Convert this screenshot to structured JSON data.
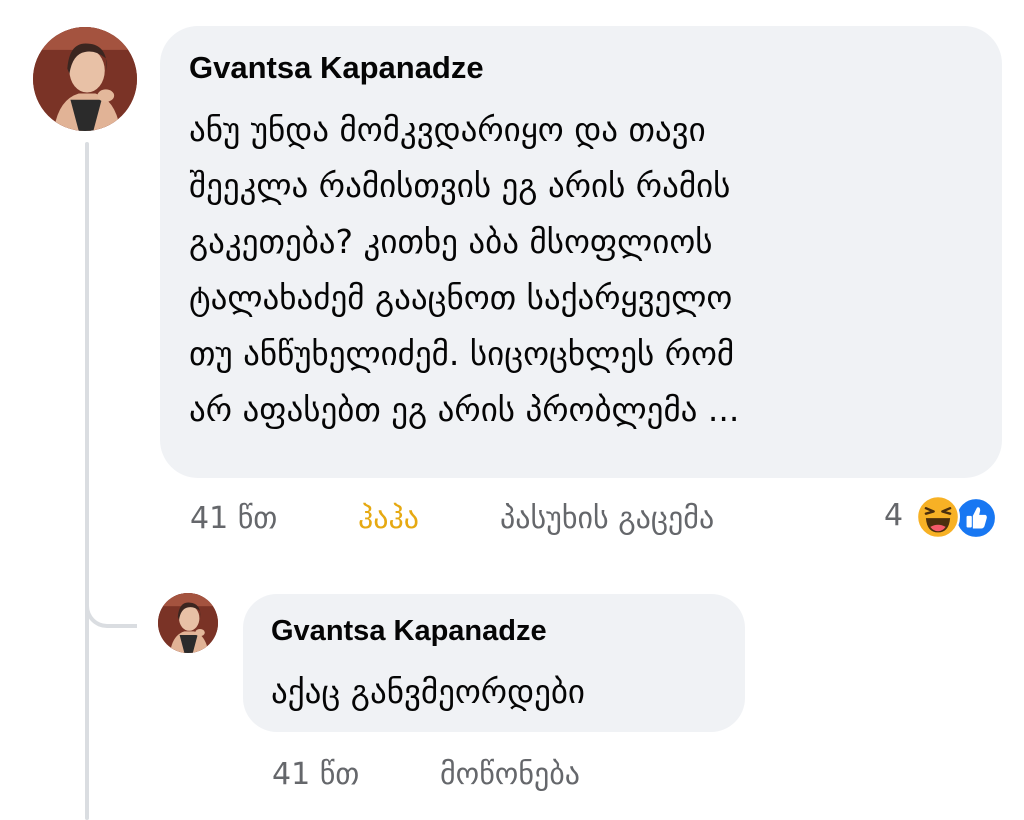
{
  "comment": {
    "author": "Gvantsa Kapanadze",
    "text": "ანუ უნდა მომკვდარიყო და თავი\nშეეკლა რამისთვის ეგ არის რამის\nგაკეთება? კითხე აბა მსოფლიოს\nტალახაძემ გააცნოთ საქარყველო\nთუ ანწუხელიძემ. სიცოცხლეს რომ\nარ აფასებთ ეგ არის პრობლემა ...",
    "time": "41 წთ",
    "reaction_action": "ჰაჰა",
    "reply_action": "პასუხის გაცემა",
    "reaction_count": "4",
    "reaction_icons": [
      "haha-emoji-icon",
      "like-emoji-icon"
    ],
    "accent_color": "#e6a911"
  },
  "reply": {
    "author": "Gvantsa Kapanadze",
    "text": "აქაც განვმეორდები",
    "time": "41 წთ",
    "like_action": "მოწონება"
  }
}
